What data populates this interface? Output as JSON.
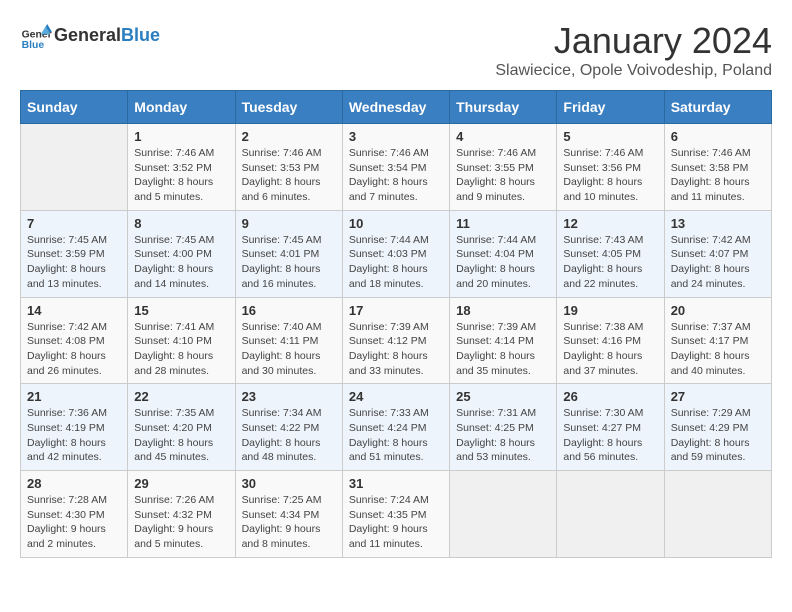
{
  "header": {
    "logo_general": "General",
    "logo_blue": "Blue",
    "month_title": "January 2024",
    "location": "Slawiecice, Opole Voivodeship, Poland"
  },
  "columns": [
    "Sunday",
    "Monday",
    "Tuesday",
    "Wednesday",
    "Thursday",
    "Friday",
    "Saturday"
  ],
  "weeks": [
    [
      {
        "day": "",
        "info": ""
      },
      {
        "day": "1",
        "info": "Sunrise: 7:46 AM\nSunset: 3:52 PM\nDaylight: 8 hours\nand 5 minutes."
      },
      {
        "day": "2",
        "info": "Sunrise: 7:46 AM\nSunset: 3:53 PM\nDaylight: 8 hours\nand 6 minutes."
      },
      {
        "day": "3",
        "info": "Sunrise: 7:46 AM\nSunset: 3:54 PM\nDaylight: 8 hours\nand 7 minutes."
      },
      {
        "day": "4",
        "info": "Sunrise: 7:46 AM\nSunset: 3:55 PM\nDaylight: 8 hours\nand 9 minutes."
      },
      {
        "day": "5",
        "info": "Sunrise: 7:46 AM\nSunset: 3:56 PM\nDaylight: 8 hours\nand 10 minutes."
      },
      {
        "day": "6",
        "info": "Sunrise: 7:46 AM\nSunset: 3:58 PM\nDaylight: 8 hours\nand 11 minutes."
      }
    ],
    [
      {
        "day": "7",
        "info": "Sunrise: 7:45 AM\nSunset: 3:59 PM\nDaylight: 8 hours\nand 13 minutes."
      },
      {
        "day": "8",
        "info": "Sunrise: 7:45 AM\nSunset: 4:00 PM\nDaylight: 8 hours\nand 14 minutes."
      },
      {
        "day": "9",
        "info": "Sunrise: 7:45 AM\nSunset: 4:01 PM\nDaylight: 8 hours\nand 16 minutes."
      },
      {
        "day": "10",
        "info": "Sunrise: 7:44 AM\nSunset: 4:03 PM\nDaylight: 8 hours\nand 18 minutes."
      },
      {
        "day": "11",
        "info": "Sunrise: 7:44 AM\nSunset: 4:04 PM\nDaylight: 8 hours\nand 20 minutes."
      },
      {
        "day": "12",
        "info": "Sunrise: 7:43 AM\nSunset: 4:05 PM\nDaylight: 8 hours\nand 22 minutes."
      },
      {
        "day": "13",
        "info": "Sunrise: 7:42 AM\nSunset: 4:07 PM\nDaylight: 8 hours\nand 24 minutes."
      }
    ],
    [
      {
        "day": "14",
        "info": "Sunrise: 7:42 AM\nSunset: 4:08 PM\nDaylight: 8 hours\nand 26 minutes."
      },
      {
        "day": "15",
        "info": "Sunrise: 7:41 AM\nSunset: 4:10 PM\nDaylight: 8 hours\nand 28 minutes."
      },
      {
        "day": "16",
        "info": "Sunrise: 7:40 AM\nSunset: 4:11 PM\nDaylight: 8 hours\nand 30 minutes."
      },
      {
        "day": "17",
        "info": "Sunrise: 7:39 AM\nSunset: 4:12 PM\nDaylight: 8 hours\nand 33 minutes."
      },
      {
        "day": "18",
        "info": "Sunrise: 7:39 AM\nSunset: 4:14 PM\nDaylight: 8 hours\nand 35 minutes."
      },
      {
        "day": "19",
        "info": "Sunrise: 7:38 AM\nSunset: 4:16 PM\nDaylight: 8 hours\nand 37 minutes."
      },
      {
        "day": "20",
        "info": "Sunrise: 7:37 AM\nSunset: 4:17 PM\nDaylight: 8 hours\nand 40 minutes."
      }
    ],
    [
      {
        "day": "21",
        "info": "Sunrise: 7:36 AM\nSunset: 4:19 PM\nDaylight: 8 hours\nand 42 minutes."
      },
      {
        "day": "22",
        "info": "Sunrise: 7:35 AM\nSunset: 4:20 PM\nDaylight: 8 hours\nand 45 minutes."
      },
      {
        "day": "23",
        "info": "Sunrise: 7:34 AM\nSunset: 4:22 PM\nDaylight: 8 hours\nand 48 minutes."
      },
      {
        "day": "24",
        "info": "Sunrise: 7:33 AM\nSunset: 4:24 PM\nDaylight: 8 hours\nand 51 minutes."
      },
      {
        "day": "25",
        "info": "Sunrise: 7:31 AM\nSunset: 4:25 PM\nDaylight: 8 hours\nand 53 minutes."
      },
      {
        "day": "26",
        "info": "Sunrise: 7:30 AM\nSunset: 4:27 PM\nDaylight: 8 hours\nand 56 minutes."
      },
      {
        "day": "27",
        "info": "Sunrise: 7:29 AM\nSunset: 4:29 PM\nDaylight: 8 hours\nand 59 minutes."
      }
    ],
    [
      {
        "day": "28",
        "info": "Sunrise: 7:28 AM\nSunset: 4:30 PM\nDaylight: 9 hours\nand 2 minutes."
      },
      {
        "day": "29",
        "info": "Sunrise: 7:26 AM\nSunset: 4:32 PM\nDaylight: 9 hours\nand 5 minutes."
      },
      {
        "day": "30",
        "info": "Sunrise: 7:25 AM\nSunset: 4:34 PM\nDaylight: 9 hours\nand 8 minutes."
      },
      {
        "day": "31",
        "info": "Sunrise: 7:24 AM\nSunset: 4:35 PM\nDaylight: 9 hours\nand 11 minutes."
      },
      {
        "day": "",
        "info": ""
      },
      {
        "day": "",
        "info": ""
      },
      {
        "day": "",
        "info": ""
      }
    ]
  ]
}
